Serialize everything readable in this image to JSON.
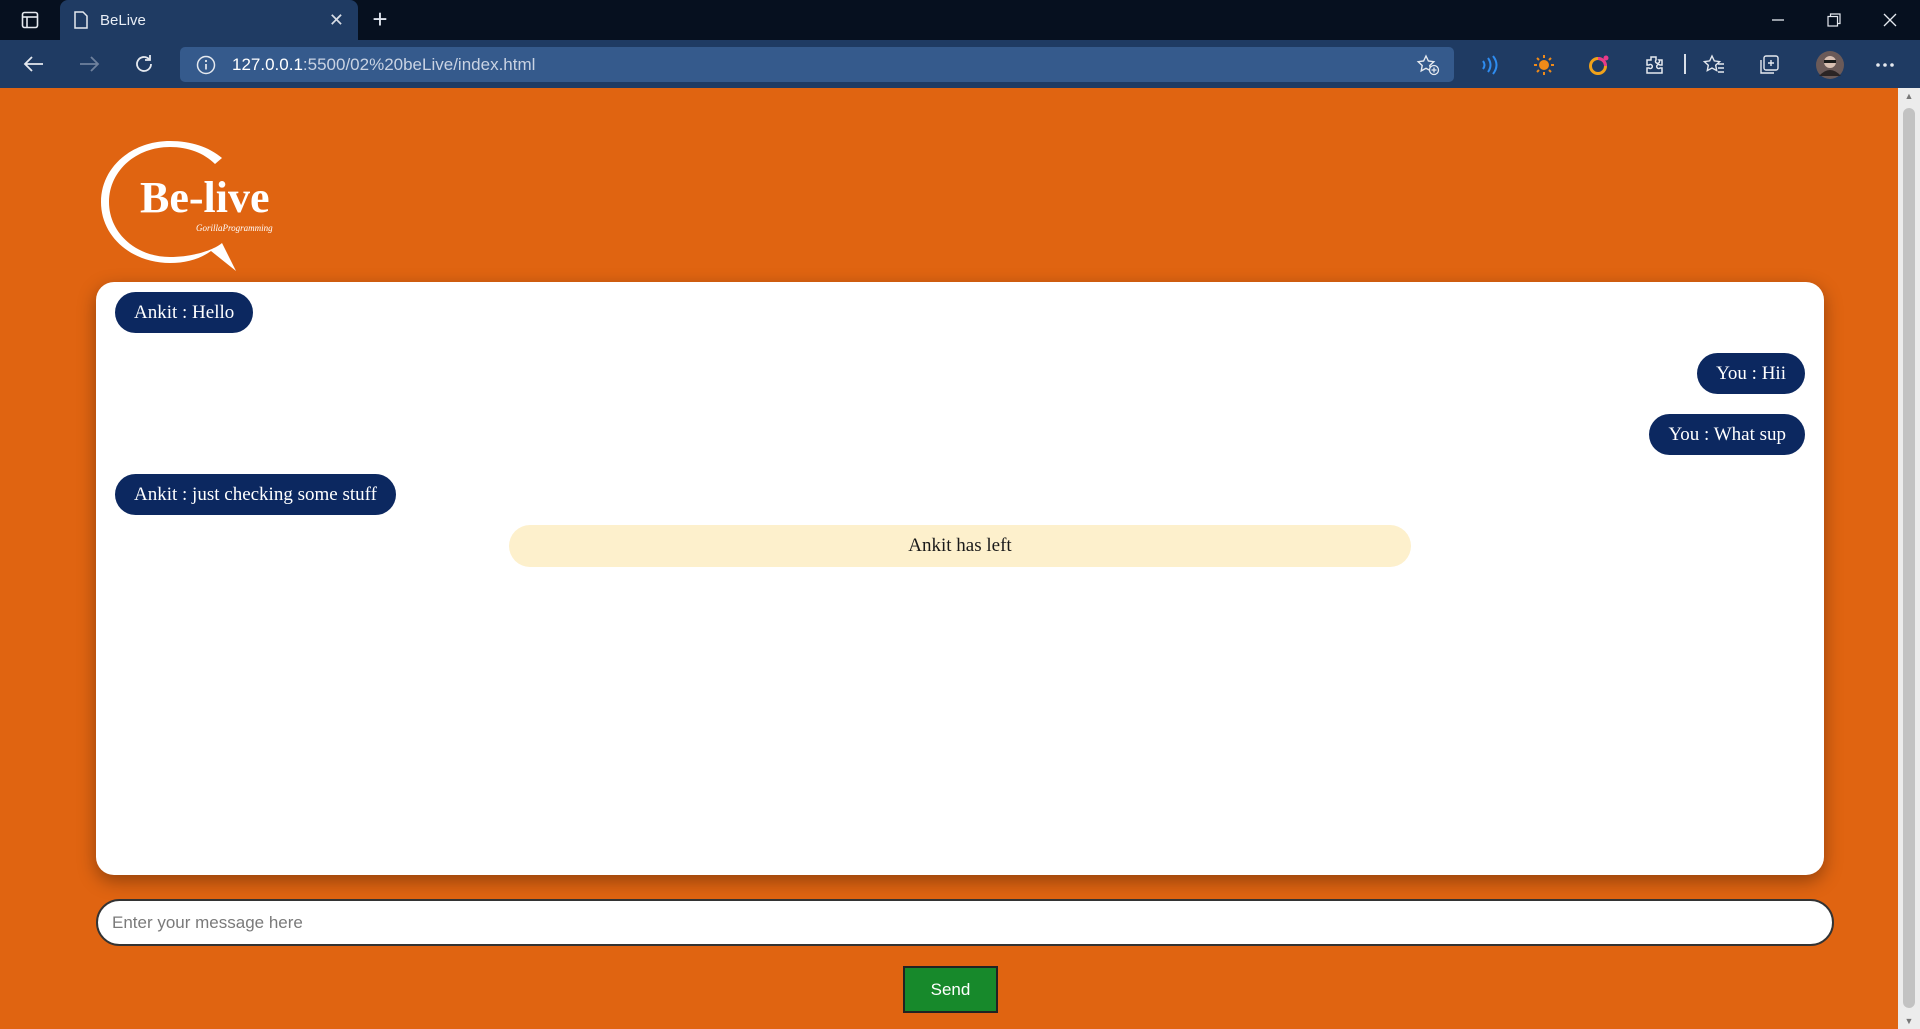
{
  "browser": {
    "tab_title": "BeLive",
    "tab_close": "✕",
    "new_tab": "+",
    "url_host": "127.0.0.1",
    "url_path": ":5500/02%20beLive/index.html"
  },
  "logo": {
    "brand": "Be-live",
    "tagline": "GorillaProgramming"
  },
  "chat": {
    "messages": [
      {
        "text": "Ankit : Hello",
        "side": "left"
      },
      {
        "text": "You : Hii",
        "side": "right"
      },
      {
        "text": "You : What sup",
        "side": "right"
      },
      {
        "text": "Ankit : just checking some stuff",
        "side": "left"
      }
    ],
    "notice": "Ankit has left"
  },
  "composer": {
    "placeholder": "Enter your message here",
    "value": "",
    "send_label": "Send"
  },
  "colors": {
    "page_bg": "#e06411",
    "bubble": "#0c2860",
    "notice_bg": "#fdf0cc",
    "send_bg": "#17892b"
  }
}
